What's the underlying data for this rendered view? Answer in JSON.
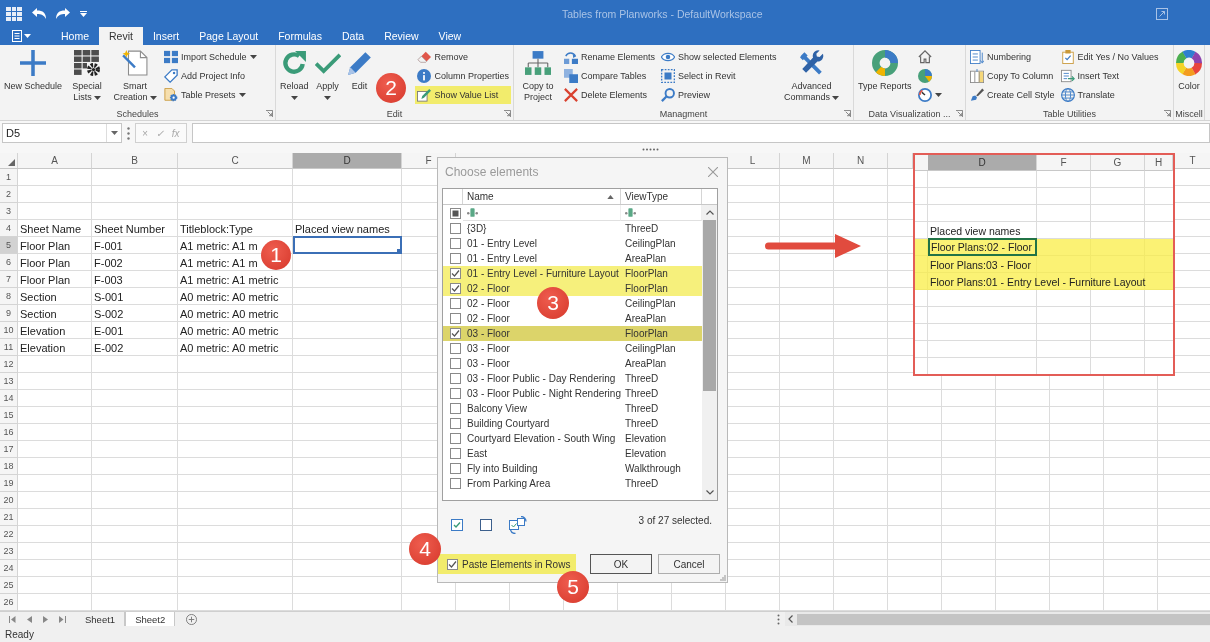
{
  "title_bar": {
    "title": "Tables from Planworks - DefaultWorkspace"
  },
  "tabs": [
    {
      "label": "Home",
      "selected": false
    },
    {
      "label": "Revit",
      "selected": true
    },
    {
      "label": "Insert",
      "selected": false
    },
    {
      "label": "Page Layout",
      "selected": false
    },
    {
      "label": "Formulas",
      "selected": false
    },
    {
      "label": "Data",
      "selected": false
    },
    {
      "label": "Review",
      "selected": false
    },
    {
      "label": "View",
      "selected": false
    }
  ],
  "ribbon": [
    {
      "label": "Schedules",
      "launcher": true,
      "items": [
        {
          "kind": "large",
          "label": "New Schedule",
          "dropdown": false
        },
        {
          "kind": "wrap",
          "label": "Special Lists",
          "dropdown": true
        },
        {
          "kind": "wrap",
          "label": "Smart Creation",
          "dropdown": true
        },
        {
          "kind": "column",
          "items": [
            {
              "label": "Import Schedule",
              "dropdown": true,
              "highlighted": false
            },
            {
              "label": "Add Project Info",
              "dropdown": false,
              "highlighted": false
            },
            {
              "label": "Table Presets",
              "dropdown": true,
              "highlighted": false
            }
          ]
        }
      ]
    },
    {
      "label": "Edit",
      "launcher": true,
      "items": [
        {
          "kind": "large",
          "label": "Reload",
          "dropdown": true
        },
        {
          "kind": "large",
          "label": "Apply",
          "dropdown": true
        },
        {
          "kind": "large",
          "label": "Edit",
          "dropdown": false
        },
        {
          "kind": "column",
          "items": [
            {
              "label": "Remove",
              "dropdown": false,
              "highlighted": false
            },
            {
              "label": "Column Properties",
              "dropdown": false,
              "highlighted": false
            },
            {
              "label": "Show Value List",
              "dropdown": false,
              "highlighted": true
            }
          ]
        }
      ]
    },
    {
      "label": "Managment",
      "launcher": true,
      "items": [
        {
          "kind": "wrap",
          "label": "Copy to Project",
          "dropdown": false
        },
        {
          "kind": "column",
          "items": [
            {
              "label": "Rename Elements",
              "dropdown": false,
              "highlighted": false
            },
            {
              "label": "Compare Tables",
              "dropdown": false,
              "highlighted": false
            },
            {
              "label": "Delete Elements",
              "dropdown": false,
              "highlighted": false
            }
          ]
        },
        {
          "kind": "column",
          "items": [
            {
              "label": "Show selected Elements",
              "dropdown": false,
              "highlighted": false
            },
            {
              "label": "Select in Revit",
              "dropdown": false,
              "highlighted": false
            },
            {
              "label": "Preview",
              "dropdown": false,
              "highlighted": false
            }
          ]
        },
        {
          "kind": "wrap",
          "label": "Advanced Commands",
          "dropdown": true
        }
      ]
    },
    {
      "label": "Data Visualization ...",
      "launcher": true,
      "items": [
        {
          "kind": "large",
          "label": "Type Reports",
          "dropdown": false
        },
        {
          "kind": "column",
          "items": [
            {
              "dropdown": false,
              "highlighted": false
            },
            {
              "dropdown": false,
              "highlighted": false
            },
            {
              "dropdown": true,
              "highlighted": false
            }
          ]
        }
      ]
    },
    {
      "label": "Table Utilities",
      "launcher": true,
      "items": [
        {
          "kind": "column",
          "items": [
            {
              "label": "Numbering",
              "dropdown": false,
              "highlighted": false
            },
            {
              "label": "Copy To Column",
              "dropdown": false,
              "highlighted": false
            },
            {
              "label": "Create Cell Style",
              "dropdown": false,
              "highlighted": false
            }
          ]
        },
        {
          "kind": "column",
          "items": [
            {
              "label": "Edit Yes / No Values",
              "dropdown": false,
              "highlighted": false
            },
            {
              "label": "Insert Text",
              "dropdown": false,
              "highlighted": false
            },
            {
              "label": "Translate",
              "dropdown": false,
              "highlighted": false
            }
          ]
        }
      ]
    },
    {
      "label": "Miscell",
      "launcher": false,
      "items": [
        {
          "kind": "large",
          "label": "Color",
          "dropdown": false
        }
      ]
    }
  ],
  "formula_bar": {
    "name_box": "D5",
    "buttons": [
      {
        "label": "×",
        "disabled": true
      },
      {
        "label": "✓",
        "disabled": true
      },
      {
        "label": "fx",
        "disabled": true
      }
    ]
  },
  "sheet": {
    "columns": [
      {
        "label": "A",
        "selected": false
      },
      {
        "label": "B",
        "selected": false
      },
      {
        "label": "C",
        "selected": false
      },
      {
        "label": "D",
        "selected": true
      },
      {
        "label": "F",
        "selected": false
      },
      {
        "label": "L",
        "selected": false
      },
      {
        "label": "M",
        "selected": false
      },
      {
        "label": "N",
        "selected": false
      },
      {
        "selected": false
      },
      {
        "label": "T",
        "selected": false
      }
    ],
    "rows": [
      {
        "number": "1",
        "selected": false
      },
      {
        "number": "2",
        "selected": false
      },
      {
        "number": "3",
        "selected": false
      },
      {
        "number": "4",
        "selected": false,
        "cells": [
          "Sheet Name",
          "Sheet Number",
          "Titleblock:Type",
          "Placed view names"
        ]
      },
      {
        "number": "5",
        "selected": true,
        "cells": [
          "Floor Plan",
          "F-001",
          "A1 metric: A1 m"
        ]
      },
      {
        "number": "6",
        "selected": false,
        "cells": [
          "Floor Plan",
          "F-002",
          "A1 metric: A1 m"
        ]
      },
      {
        "number": "7",
        "selected": false,
        "cells": [
          "Floor Plan",
          "F-003",
          "A1 metric: A1 metric"
        ]
      },
      {
        "number": "8",
        "selected": false,
        "cells": [
          "Section",
          "S-001",
          "A0 metric: A0 metric"
        ]
      },
      {
        "number": "9",
        "selected": false,
        "cells": [
          "Section",
          "S-002",
          "A0 metric: A0 metric"
        ]
      },
      {
        "number": "10",
        "selected": false,
        "cells": [
          "Elevation",
          "E-001",
          "A0 metric: A0 metric"
        ]
      },
      {
        "number": "11",
        "selected": false,
        "cells": [
          "Elevation",
          "E-002",
          "A0 metric: A0 metric"
        ]
      },
      {
        "number": "12",
        "selected": false
      },
      {
        "number": "13",
        "selected": false
      },
      {
        "number": "14",
        "selected": false
      },
      {
        "number": "15",
        "selected": false
      },
      {
        "number": "16",
        "selected": false
      },
      {
        "number": "17",
        "selected": false
      },
      {
        "number": "18",
        "selected": false
      },
      {
        "number": "19",
        "selected": false
      },
      {
        "number": "20",
        "selected": false
      },
      {
        "number": "21",
        "selected": false
      },
      {
        "number": "22",
        "selected": false
      },
      {
        "number": "23",
        "selected": false
      },
      {
        "number": "24",
        "selected": false
      },
      {
        "number": "25",
        "selected": false
      },
      {
        "number": "26",
        "selected": false
      }
    ]
  },
  "zoom_inset": {
    "columns": [
      {
        "label": "D",
        "selected": true
      },
      {
        "label": "F",
        "selected": false
      },
      {
        "label": "G",
        "selected": false
      },
      {
        "label": "H",
        "selected": false
      }
    ],
    "cells": [
      {
        "text": "Placed view names",
        "highlighted": false,
        "selected": false
      },
      {
        "text": "Floor Plans:02 - Floor",
        "highlighted": true,
        "selected": true
      },
      {
        "text": "Floor Plans:03 - Floor",
        "highlighted": true,
        "selected": false
      },
      {
        "text": "Floor Plans:01 - Entry Level - Furniture Layout",
        "highlighted": true,
        "selected": false
      }
    ]
  },
  "dialog": {
    "title": "Choose elements",
    "columns": [
      {
        "label": "Name",
        "sorted": true
      },
      {
        "label": "ViewType",
        "sorted": false
      }
    ],
    "select_all_indeterminate": true,
    "rows": [
      {
        "name": "{3D}",
        "view_type": "ThreeD",
        "checked": false,
        "highlighted": false,
        "selected": false
      },
      {
        "name": "01 - Entry Level",
        "view_type": "CeilingPlan",
        "checked": false,
        "highlighted": false,
        "selected": false
      },
      {
        "name": "01 - Entry Level",
        "view_type": "AreaPlan",
        "checked": false,
        "highlighted": false,
        "selected": false
      },
      {
        "name": "01 - Entry Level - Furniture Layout",
        "view_type": "FloorPlan",
        "checked": true,
        "highlighted": true,
        "selected": false
      },
      {
        "name": "02 - Floor",
        "view_type": "FloorPlan",
        "checked": true,
        "highlighted": true,
        "selected": false
      },
      {
        "name": "02 - Floor",
        "view_type": "CeilingPlan",
        "checked": false,
        "highlighted": false,
        "selected": false
      },
      {
        "name": "02 - Floor",
        "view_type": "AreaPlan",
        "checked": false,
        "highlighted": false,
        "selected": false
      },
      {
        "name": "03 - Floor",
        "view_type": "FloorPlan",
        "checked": true,
        "highlighted": true,
        "selected": true
      },
      {
        "name": "03 - Floor",
        "view_type": "CeilingPlan",
        "checked": false,
        "highlighted": false,
        "selected": false
      },
      {
        "name": "03 - Floor",
        "view_type": "AreaPlan",
        "checked": false,
        "highlighted": false,
        "selected": false
      },
      {
        "name": "03 - Floor Public - Day Rendering",
        "view_type": "ThreeD",
        "checked": false,
        "highlighted": false,
        "selected": false
      },
      {
        "name": "03 - Floor Public - Night Rendering",
        "view_type": "ThreeD",
        "checked": false,
        "highlighted": false,
        "selected": false
      },
      {
        "name": "Balcony View",
        "view_type": "ThreeD",
        "checked": false,
        "highlighted": false,
        "selected": false
      },
      {
        "name": "Building Courtyard",
        "view_type": "ThreeD",
        "checked": false,
        "highlighted": false,
        "selected": false
      },
      {
        "name": "Courtyard Elevation - South Wing",
        "view_type": "Elevation",
        "checked": false,
        "highlighted": false,
        "selected": false
      },
      {
        "name": "East",
        "view_type": "Elevation",
        "checked": false,
        "highlighted": false,
        "selected": false
      },
      {
        "name": "Fly into Building",
        "view_type": "Walkthrough",
        "checked": false,
        "highlighted": false,
        "selected": false
      },
      {
        "name": "From Parking Area",
        "view_type": "ThreeD",
        "checked": false,
        "highlighted": false,
        "selected": false
      }
    ],
    "selection_count": "3 of 27 selected.",
    "paste_in_rows": {
      "label": "Paste Elements in Rows",
      "checked": true,
      "highlighted": true
    },
    "buttons": [
      {
        "label": "OK",
        "default": true
      },
      {
        "label": "Cancel",
        "default": false
      }
    ]
  },
  "callouts": [
    "1",
    "2",
    "3",
    "4",
    "5"
  ],
  "sheet_tabs": [
    {
      "label": "Sheet1",
      "selected": false
    },
    {
      "label": "Sheet2",
      "selected": true
    }
  ],
  "status_bar": {
    "text": "Ready"
  }
}
